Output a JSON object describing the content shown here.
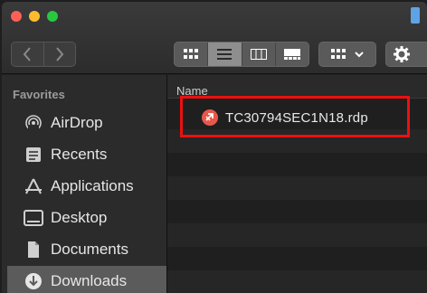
{
  "window": {
    "nav": {
      "back_icon": "chevron-left-icon",
      "forward_icon": "chevron-right-icon"
    },
    "views": [
      "icon-view-icon",
      "list-view-icon",
      "column-view-icon",
      "gallery-view-icon"
    ],
    "active_view": "list"
  },
  "sidebar": {
    "section_title": "Favorites",
    "items": [
      {
        "label": "AirDrop",
        "icon": "airdrop-icon"
      },
      {
        "label": "Recents",
        "icon": "recents-icon"
      },
      {
        "label": "Applications",
        "icon": "applications-icon"
      },
      {
        "label": "Desktop",
        "icon": "desktop-icon"
      },
      {
        "label": "Documents",
        "icon": "documents-icon"
      },
      {
        "label": "Downloads",
        "icon": "downloads-icon",
        "selected": true
      }
    ]
  },
  "content": {
    "column_header": "Name",
    "files": [
      {
        "name": "TC30794SEC1N18.rdp",
        "icon": "rdp-file-icon"
      }
    ]
  },
  "colors": {
    "highlight": "#ec1010",
    "rdp_icon": "#e8574a",
    "selected_sidebar": "#5b5b5b"
  }
}
